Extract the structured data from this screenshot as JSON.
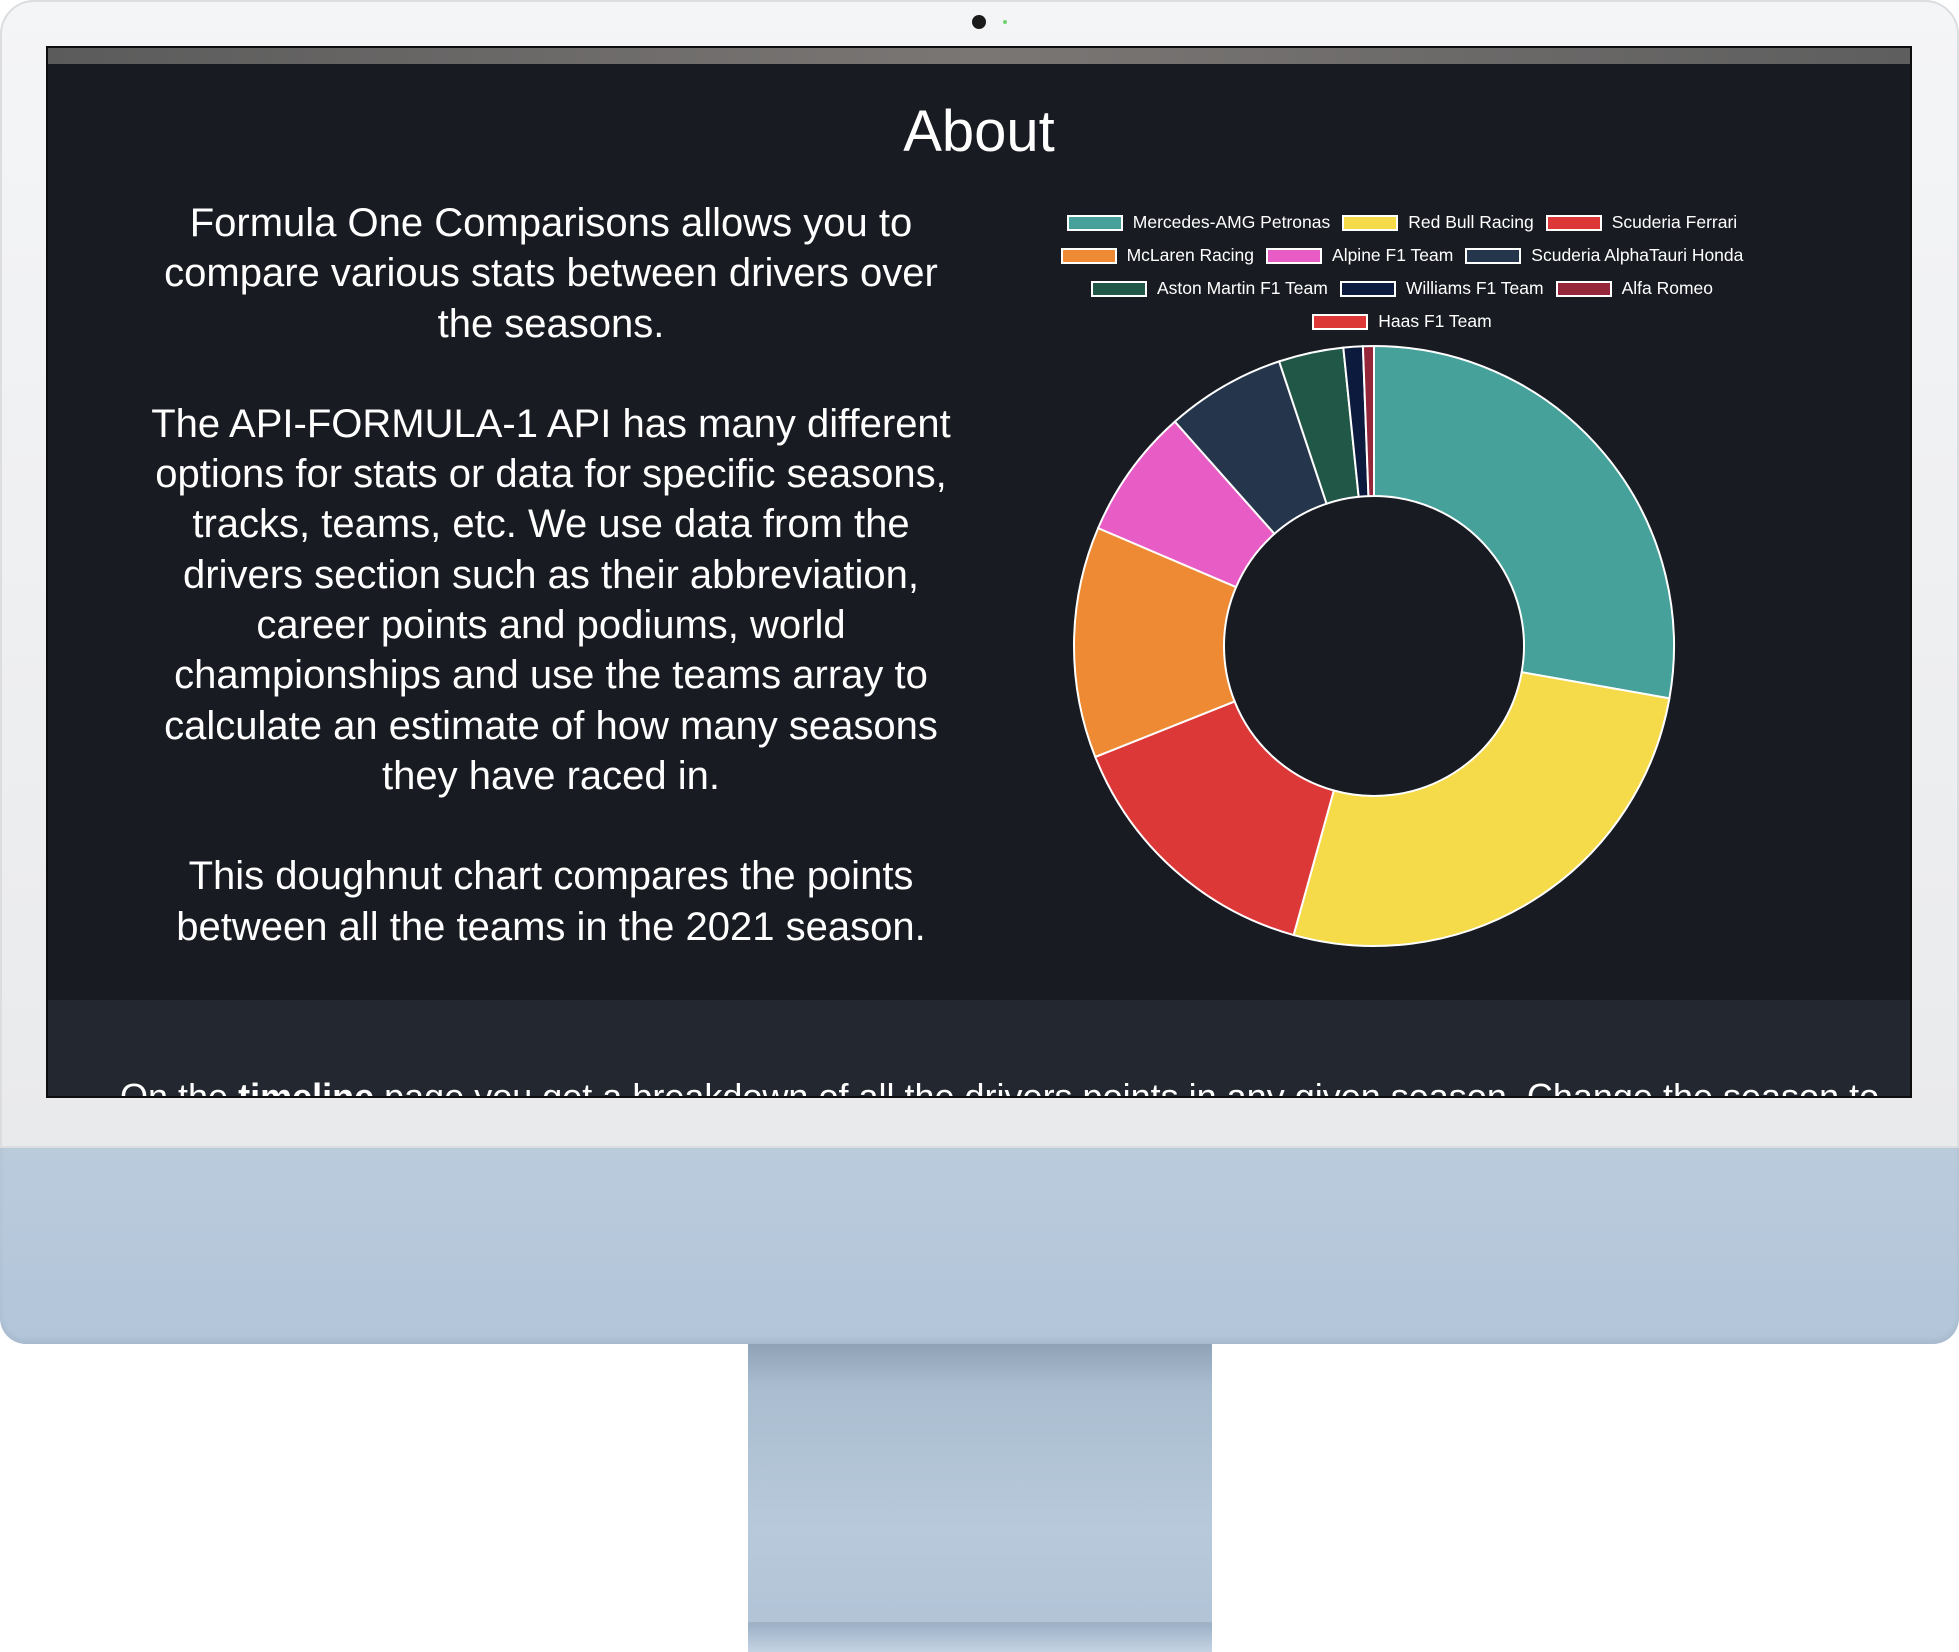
{
  "about": {
    "title": "About",
    "paragraphs": [
      "Formula One Comparisons allows you to compare various stats between drivers over the seasons.",
      "The API-FORMULA-1 API has many different options for stats or data for specific seasons, tracks, teams, etc. We use data from the drivers section such as their abbreviation, career points and podiums, world championships and use the teams array to calculate an estimate of how many seasons they have raced in.",
      "This doughnut chart compares the points between all the teams in the 2021 season."
    ]
  },
  "timeline_section": {
    "text_before": "On the ",
    "bold": "timeline",
    "text_after": " page you get a breakdown of all the drivers points in any given season. Change the season to"
  },
  "chart_data": {
    "type": "pie",
    "variant": "doughnut",
    "title": "",
    "legend_position": "top",
    "categories": [
      "Mercedes-AMG Petronas",
      "Red Bull Racing",
      "Scuderia Ferrari",
      "McLaren Racing",
      "Alpine F1 Team",
      "Scuderia AlphaTauri Honda",
      "Aston Martin F1 Team",
      "Williams F1 Team",
      "Alfa Romeo",
      "Haas F1 Team"
    ],
    "values": [
      613.5,
      585.5,
      323.5,
      275,
      155,
      142,
      77,
      23,
      13,
      0
    ],
    "colors": [
      "#45a19a",
      "#f5da4a",
      "#dd3838",
      "#ee8a34",
      "#e85cc5",
      "#25364c",
      "#215747",
      "#0c1a3e",
      "#96263a",
      "#dd3838"
    ]
  }
}
